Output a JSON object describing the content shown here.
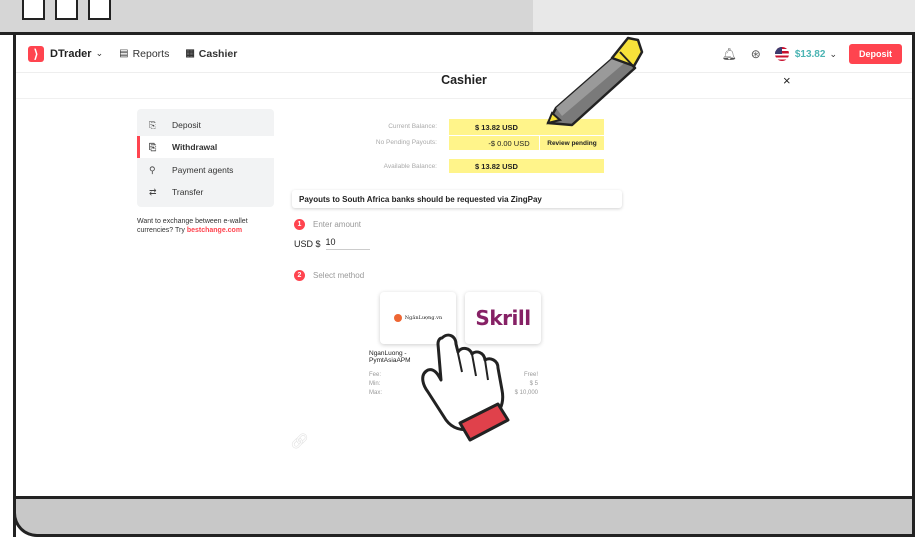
{
  "header": {
    "brand": "DTrader",
    "nav_reports": "Reports",
    "nav_cashier": "Cashier",
    "balance": "$13.82",
    "deposit_label": "Deposit"
  },
  "cashier": {
    "title": "Cashier",
    "close": "×"
  },
  "side_menu": {
    "items": [
      {
        "label": "Deposit"
      },
      {
        "label": "Withdrawal"
      },
      {
        "label": "Payment agents"
      },
      {
        "label": "Transfer"
      }
    ],
    "exchange_text": "Want to exchange between e-wallet currencies? Try",
    "exchange_link": "bestchange.com"
  },
  "balances": {
    "current_label": "Current Balance:",
    "current_value": "$ 13.82 USD",
    "pending_label": "No Pending Payouts:",
    "pending_value": "-$ 0.00 USD",
    "review_label": "Review pending",
    "available_label": "Available Balance:",
    "available_value": "$ 13.82 USD"
  },
  "notice": "Payouts to South Africa banks should be requested via ZingPay",
  "steps": {
    "one_num": "1",
    "one_label": "Enter amount",
    "currency": "USD $",
    "amount": "10",
    "two_num": "2",
    "two_label": "Select method"
  },
  "methods": {
    "nganluong_logo": "NgânLượng.vn",
    "skrill_logo": "Skrill",
    "nganluong_name_1": "NganLuong -",
    "nganluong_name_2": "PymtAsiaAPM",
    "fee_label": "Fee:",
    "min_label": "Min:",
    "max_label": "Max:",
    "fee_value": "Free!",
    "min_value": "$ 5",
    "max_value": "$ 10,000"
  },
  "colors": {
    "accent": "#ff444f",
    "highlight": "#fff48a",
    "balance_teal": "#4bb4b3",
    "skrill_purple": "#862165"
  }
}
